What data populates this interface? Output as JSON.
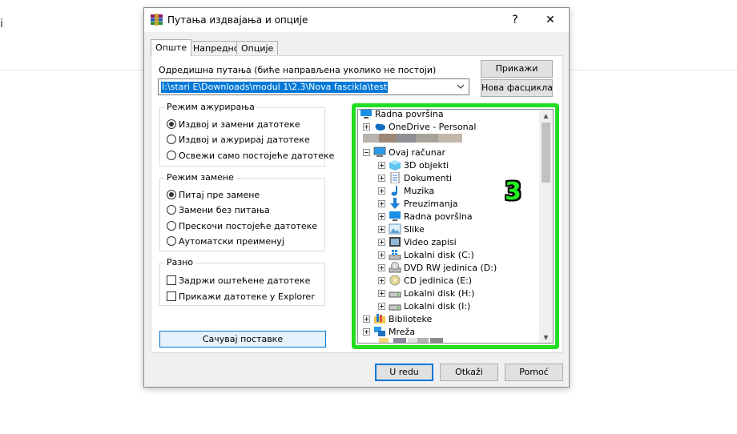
{
  "background": {
    "fragment": "i"
  },
  "window": {
    "title": "Путања издвајања и опције",
    "help_symbol": "?",
    "close_symbol": "✕"
  },
  "tabs": [
    {
      "label": "Опште",
      "active": true
    },
    {
      "label": "Напредно",
      "active": false
    },
    {
      "label": "Опције",
      "active": false
    }
  ],
  "destination": {
    "label": "Одредишна путања (биће направљена уколико не постоји)",
    "path": "I:\\stari E\\Downloads\\modul 1\\2.3\\Nova fascikla\\test"
  },
  "buttons": {
    "show": "Прикажи",
    "new_folder": "Нова фасцикла",
    "save_settings": "Сачувај поставке",
    "ok": "U redu",
    "cancel": "Otkaži",
    "help": "Pomoć"
  },
  "update_mode": {
    "title": "Режим ажурирања",
    "options": [
      {
        "label": "Издвој и замени датотеке",
        "selected": true
      },
      {
        "label": "Издвој и ажурирај датотеке",
        "selected": false
      },
      {
        "label": "Освежи само постојеће датотеке",
        "selected": false
      }
    ]
  },
  "overwrite_mode": {
    "title": "Режим замене",
    "options": [
      {
        "label": "Питај пре замене",
        "selected": true
      },
      {
        "label": "Замени без питања",
        "selected": false
      },
      {
        "label": "Прескочи постојеће датотеке",
        "selected": false
      },
      {
        "label": "Аутоматски преименуј",
        "selected": false
      }
    ]
  },
  "misc": {
    "title": "Разно",
    "options": [
      {
        "label": "Задржи оштећене датотеке",
        "checked": false
      },
      {
        "label": "Прикажи датотеке у Explorer",
        "checked": false
      }
    ]
  },
  "tree": {
    "items": [
      {
        "label": "Radna površina",
        "icon": "desktop-icon"
      },
      {
        "label": "OneDrive - Personal",
        "icon": "cloud-icon"
      },
      {
        "label": "Ovaj računar",
        "icon": "computer-icon"
      },
      {
        "label": "3D objekti",
        "icon": "cube-icon"
      },
      {
        "label": "Dokumenti",
        "icon": "document-icon"
      },
      {
        "label": "Muzika",
        "icon": "music-icon"
      },
      {
        "label": "Preuzimanja",
        "icon": "download-icon"
      },
      {
        "label": "Radna površina",
        "icon": "desktop-icon"
      },
      {
        "label": "Slike",
        "icon": "picture-icon"
      },
      {
        "label": "Video zapisi",
        "icon": "video-icon"
      },
      {
        "label": "Lokalni disk (C:)",
        "icon": "windows-drive-icon"
      },
      {
        "label": "DVD RW jedinica (D:)",
        "icon": "dvd-icon"
      },
      {
        "label": "CD jedinica (E:)",
        "icon": "cd-icon"
      },
      {
        "label": "Lokalni disk (H:)",
        "icon": "drive-icon"
      },
      {
        "label": "Lokalni disk (I:)",
        "icon": "drive-icon"
      },
      {
        "label": "Biblioteke",
        "icon": "library-icon"
      },
      {
        "label": "Mreža",
        "icon": "network-icon"
      }
    ]
  },
  "annotation": {
    "text": "3",
    "color": "#22ee22"
  }
}
